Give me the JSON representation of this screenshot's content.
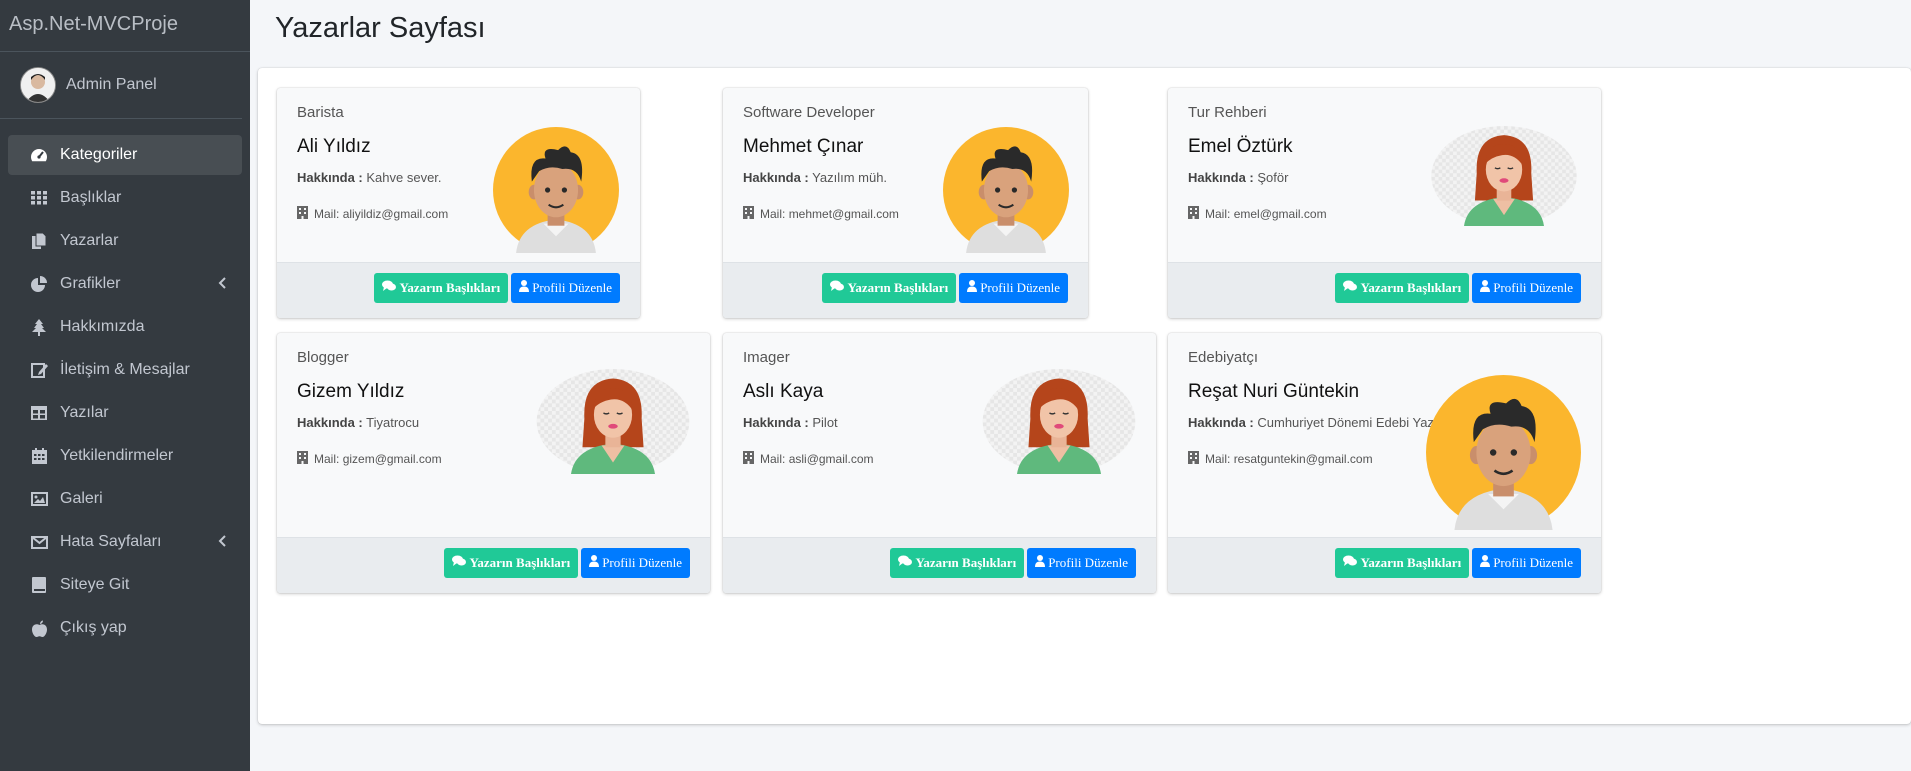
{
  "brand": "Asp.Net-MVCProje",
  "user": {
    "name": "Admin Panel"
  },
  "nav": [
    {
      "label": "Kategoriler",
      "icon": "tachometer-icon",
      "active": true
    },
    {
      "label": "Başlıklar",
      "icon": "grid-icon"
    },
    {
      "label": "Yazarlar",
      "icon": "copy-icon"
    },
    {
      "label": "Grafikler",
      "icon": "pie-chart-icon",
      "arrow": true
    },
    {
      "label": "Hakkımızda",
      "icon": "tree-icon"
    },
    {
      "label": "İletişim & Mesajlar",
      "icon": "edit-icon"
    },
    {
      "label": "Yazılar",
      "icon": "table-icon"
    },
    {
      "label": "Yetkilendirmeler",
      "icon": "calendar-icon"
    },
    {
      "label": "Galeri",
      "icon": "image-icon"
    },
    {
      "label": "Hata Sayfaları",
      "icon": "envelope-icon",
      "arrow": true
    },
    {
      "label": "Siteye Git",
      "icon": "book-icon"
    },
    {
      "label": "Çıkış yap",
      "icon": "apple-icon"
    }
  ],
  "page": {
    "title": "Yazarlar Sayfası"
  },
  "labels": {
    "about": "Hakkında :",
    "mail": "Mail:",
    "btn_titles": "Yazarın Başlıkları",
    "btn_edit": "Profili Düzenle"
  },
  "writers": [
    {
      "job": "Barista",
      "name": "Ali Yıldız",
      "about": "Kahve sever.",
      "mail": "aliyildiz@gmail.com",
      "avatar": "male-avatar"
    },
    {
      "job": "Software Developer",
      "name": "Mehmet Çınar",
      "about": "Yazılım müh.",
      "mail": "mehmet@gmail.com",
      "avatar": "male-avatar"
    },
    {
      "job": "Tur Rehberi",
      "name": "Emel Öztürk",
      "about": "Şoför",
      "mail": "emel@gmail.com",
      "avatar": "female-avatar"
    },
    {
      "job": "Blogger",
      "name": "Gizem Yıldız",
      "about": "Tiyatrocu",
      "mail": "gizem@gmail.com",
      "avatar": "female-avatar"
    },
    {
      "job": "Imager",
      "name": "Aslı Kaya",
      "about": "Pilot",
      "mail": "asli@gmail.com",
      "avatar": "female-avatar"
    },
    {
      "job": "Edebiyatçı",
      "name": "Reşat Nuri Güntekin",
      "about": "Cumhuriyet Dönemi Edebi Yazarı",
      "mail": "resatguntekin@gmail.com",
      "avatar": "male-avatar"
    }
  ]
}
